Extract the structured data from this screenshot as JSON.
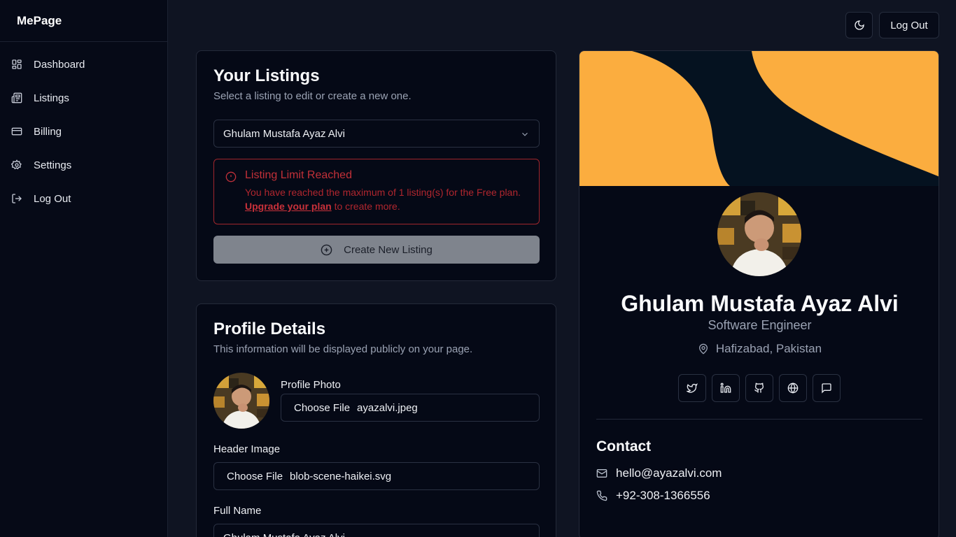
{
  "sidebar": {
    "brand": "MePage",
    "items": [
      {
        "label": "Dashboard",
        "icon": "dashboard-icon"
      },
      {
        "label": "Listings",
        "icon": "listings-icon"
      },
      {
        "label": "Billing",
        "icon": "billing-icon"
      },
      {
        "label": "Settings",
        "icon": "settings-icon"
      },
      {
        "label": "Log Out",
        "icon": "logout-icon"
      }
    ]
  },
  "topbar": {
    "theme_icon": "moon-icon",
    "logout_label": "Log Out"
  },
  "listings": {
    "title": "Your Listings",
    "subtitle": "Select a listing to edit or create a new one.",
    "selected": "Ghulam Mustafa Ayaz Alvi",
    "alert": {
      "title": "Listing Limit Reached",
      "body_before": "You have reached the maximum of 1 listing(s) for the Free plan.",
      "link": "Upgrade your plan",
      "body_after": "to create more."
    },
    "create_label": "Create New Listing"
  },
  "profile": {
    "title": "Profile Details",
    "subtitle": "This information will be displayed publicly on your page.",
    "photo_label": "Profile Photo",
    "photo_button": "Choose File",
    "photo_file": "ayazalvi.jpeg",
    "header_label": "Header Image",
    "header_button": "Choose File",
    "header_file": "blob-scene-haikei.svg",
    "name_label": "Full Name",
    "name_value": "Ghulam Mustafa Ayaz Alvi"
  },
  "preview": {
    "name": "Ghulam Mustafa Ayaz Alvi",
    "role": "Software Engineer",
    "location": "Hafizabad, Pakistan",
    "socials": [
      "twitter-icon",
      "linkedin-icon",
      "github-icon",
      "globe-icon",
      "message-icon"
    ],
    "contact_title": "Contact",
    "email": "hello@ayazalvi.com",
    "phone": "+92-308-1366556"
  },
  "colors": {
    "background": "#0f1422",
    "card": "#050916",
    "accent_orange": "#fbad3f",
    "alert_red": "#b3262e",
    "disabled_button": "#7f848d"
  }
}
